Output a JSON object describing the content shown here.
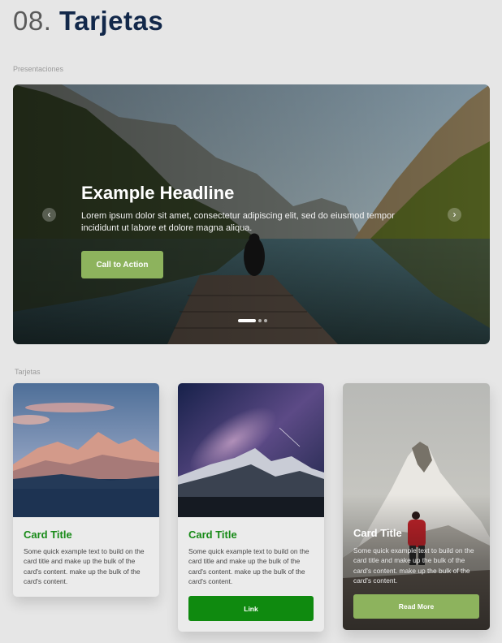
{
  "header": {
    "number": "08.",
    "title": "Tarjetas"
  },
  "sections": {
    "presentations_label": "Presentaciones",
    "cards_label": "Tarjetas"
  },
  "carousel": {
    "headline": "Example Headline",
    "body": "Lorem ipsum dolor sit amet, consectetur adipiscing elit, sed do eiusmod tempor incididunt ut labore et dolore magna aliqua.",
    "cta_label": "Call to Action",
    "prev_icon": "chevron-left-icon",
    "next_icon": "chevron-right-icon",
    "slide_count": 3,
    "active_slide": 1
  },
  "cards": [
    {
      "title": "Card Title",
      "text": "Some quick example text to build on the card title and make up the bulk of the card's content.  make up the bulk of the card's content."
    },
    {
      "title": "Card Title",
      "text": "Some quick example text to build on the card title and make up the bulk of the card's content.  make up the bulk of the card's content.",
      "button_label": "Link"
    },
    {
      "title": "Card Title",
      "text": "Some quick example text to build on the card title and make up the bulk of the card's content.  make up the bulk of the card's content.",
      "button_label": "Read More"
    }
  ],
  "colors": {
    "background": "#e6e6e6",
    "title_dark": "#12284a",
    "green_text": "#178a17",
    "green_button": "#0f8a0f",
    "light_green_button": "#8db35d"
  }
}
